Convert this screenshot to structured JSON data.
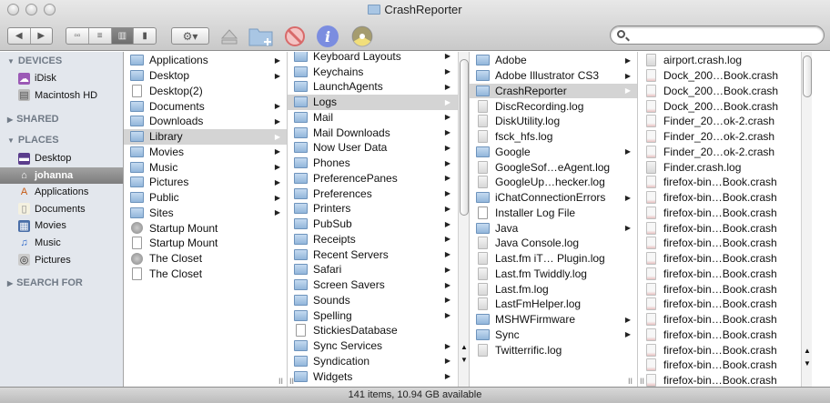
{
  "window": {
    "title": "CrashReporter"
  },
  "toolbar": {
    "nav": [
      {
        "name": "back-button",
        "icon": "◀"
      },
      {
        "name": "forward-button",
        "icon": "▶"
      }
    ],
    "views": [
      {
        "name": "icon-view-button",
        "icon": "▫▫",
        "active": false
      },
      {
        "name": "list-view-button",
        "icon": "≡",
        "active": false
      },
      {
        "name": "column-view-button",
        "icon": "▥",
        "active": true
      },
      {
        "name": "coverflow-view-button",
        "icon": "▮",
        "active": false
      }
    ],
    "action_icon": "⚙▾",
    "search": {
      "value": "",
      "placeholder": ""
    }
  },
  "sidebar": {
    "sections": [
      {
        "label": "DEVICES",
        "expanded": true,
        "items": [
          {
            "label": "iDisk",
            "icon": "idisk"
          },
          {
            "label": "Macintosh HD",
            "icon": "harddisk"
          }
        ]
      },
      {
        "label": "SHARED",
        "expanded": false,
        "items": []
      },
      {
        "label": "PLACES",
        "expanded": true,
        "items": [
          {
            "label": "Desktop",
            "icon": "desktop"
          },
          {
            "label": "johanna",
            "icon": "home",
            "selected": true
          },
          {
            "label": "Applications",
            "icon": "applications"
          },
          {
            "label": "Documents",
            "icon": "documents"
          },
          {
            "label": "Movies",
            "icon": "movies"
          },
          {
            "label": "Music",
            "icon": "music"
          },
          {
            "label": "Pictures",
            "icon": "pictures"
          }
        ]
      },
      {
        "label": "SEARCH FOR",
        "expanded": false,
        "items": []
      }
    ]
  },
  "columns": [
    {
      "items": [
        {
          "label": "Applications",
          "kind": "folder",
          "arrow": true
        },
        {
          "label": "Desktop",
          "kind": "folder",
          "arrow": true
        },
        {
          "label": "Desktop(2)",
          "kind": "doc"
        },
        {
          "label": "Documents",
          "kind": "folder",
          "arrow": true
        },
        {
          "label": "Downloads",
          "kind": "folder",
          "arrow": true
        },
        {
          "label": "Library",
          "kind": "folder",
          "arrow": true,
          "selected": true
        },
        {
          "label": "Movies",
          "kind": "folder",
          "arrow": true
        },
        {
          "label": "Music",
          "kind": "folder",
          "arrow": true
        },
        {
          "label": "Pictures",
          "kind": "folder",
          "arrow": true
        },
        {
          "label": "Public",
          "kind": "folder",
          "arrow": true
        },
        {
          "label": "Sites",
          "kind": "folder",
          "arrow": true
        },
        {
          "label": "Startup Mount",
          "kind": "alias"
        },
        {
          "label": "Startup Mount",
          "kind": "doc"
        },
        {
          "label": "The Closet",
          "kind": "alias"
        },
        {
          "label": "The Closet",
          "kind": "doc"
        }
      ]
    },
    {
      "items": [
        {
          "label": "Keyboard Layouts",
          "kind": "folder",
          "arrow": true
        },
        {
          "label": "Keychains",
          "kind": "folder",
          "arrow": true
        },
        {
          "label": "LaunchAgents",
          "kind": "folder",
          "arrow": true
        },
        {
          "label": "Logs",
          "kind": "folder",
          "arrow": true,
          "selected": true
        },
        {
          "label": "Mail",
          "kind": "folder",
          "arrow": true
        },
        {
          "label": "Mail Downloads",
          "kind": "folder",
          "arrow": true
        },
        {
          "label": "Now User Data",
          "kind": "folder",
          "arrow": true
        },
        {
          "label": "Phones",
          "kind": "folder",
          "arrow": true
        },
        {
          "label": "PreferencePanes",
          "kind": "folder",
          "arrow": true
        },
        {
          "label": "Preferences",
          "kind": "folder",
          "arrow": true
        },
        {
          "label": "Printers",
          "kind": "folder",
          "arrow": true
        },
        {
          "label": "PubSub",
          "kind": "folder",
          "arrow": true
        },
        {
          "label": "Receipts",
          "kind": "folder",
          "arrow": true
        },
        {
          "label": "Recent Servers",
          "kind": "folder",
          "arrow": true
        },
        {
          "label": "Safari",
          "kind": "folder",
          "arrow": true
        },
        {
          "label": "Screen Savers",
          "kind": "folder",
          "arrow": true
        },
        {
          "label": "Sounds",
          "kind": "folder",
          "arrow": true
        },
        {
          "label": "Spelling",
          "kind": "folder",
          "arrow": true
        },
        {
          "label": "StickiesDatabase",
          "kind": "doc"
        },
        {
          "label": "Sync Services",
          "kind": "folder",
          "arrow": true
        },
        {
          "label": "Syndication",
          "kind": "folder",
          "arrow": true
        },
        {
          "label": "Widgets",
          "kind": "folder",
          "arrow": true
        }
      ]
    },
    {
      "items": [
        {
          "label": "Adobe",
          "kind": "folder",
          "arrow": true
        },
        {
          "label": "Adobe Illustrator CS3",
          "kind": "folder",
          "arrow": true
        },
        {
          "label": "CrashReporter",
          "kind": "folder",
          "arrow": true,
          "selected": true
        },
        {
          "label": "DiscRecording.log",
          "kind": "log"
        },
        {
          "label": "DiskUtility.log",
          "kind": "log"
        },
        {
          "label": "fsck_hfs.log",
          "kind": "log"
        },
        {
          "label": "Google",
          "kind": "folder",
          "arrow": true
        },
        {
          "label": "GoogleSof…eAgent.log",
          "kind": "log"
        },
        {
          "label": "GoogleUp…hecker.log",
          "kind": "log"
        },
        {
          "label": "iChatConnectionErrors",
          "kind": "folder",
          "arrow": true
        },
        {
          "label": "Installer Log File",
          "kind": "doc"
        },
        {
          "label": "Java",
          "kind": "folder",
          "arrow": true
        },
        {
          "label": "Java Console.log",
          "kind": "log"
        },
        {
          "label": "Last.fm iT… Plugin.log",
          "kind": "log"
        },
        {
          "label": "Last.fm Twiddly.log",
          "kind": "log"
        },
        {
          "label": "Last.fm.log",
          "kind": "log"
        },
        {
          "label": "LastFmHelper.log",
          "kind": "log"
        },
        {
          "label": "MSHWFirmware",
          "kind": "folder",
          "arrow": true
        },
        {
          "label": "Sync",
          "kind": "folder",
          "arrow": true
        },
        {
          "label": "Twitterrific.log",
          "kind": "log"
        }
      ]
    },
    {
      "items": [
        {
          "label": "airport.crash.log",
          "kind": "log"
        },
        {
          "label": "Dock_200…Book.crash",
          "kind": "crash"
        },
        {
          "label": "Dock_200…Book.crash",
          "kind": "crash"
        },
        {
          "label": "Dock_200…Book.crash",
          "kind": "crash"
        },
        {
          "label": "Finder_20…ok-2.crash",
          "kind": "crash"
        },
        {
          "label": "Finder_20…ok-2.crash",
          "kind": "crash"
        },
        {
          "label": "Finder_20…ok-2.crash",
          "kind": "crash"
        },
        {
          "label": "Finder.crash.log",
          "kind": "log"
        },
        {
          "label": "firefox-bin…Book.crash",
          "kind": "crash"
        },
        {
          "label": "firefox-bin…Book.crash",
          "kind": "crash"
        },
        {
          "label": "firefox-bin…Book.crash",
          "kind": "crash"
        },
        {
          "label": "firefox-bin…Book.crash",
          "kind": "crash"
        },
        {
          "label": "firefox-bin…Book.crash",
          "kind": "crash"
        },
        {
          "label": "firefox-bin…Book.crash",
          "kind": "crash"
        },
        {
          "label": "firefox-bin…Book.crash",
          "kind": "crash"
        },
        {
          "label": "firefox-bin…Book.crash",
          "kind": "crash"
        },
        {
          "label": "firefox-bin…Book.crash",
          "kind": "crash"
        },
        {
          "label": "firefox-bin…Book.crash",
          "kind": "crash"
        },
        {
          "label": "firefox-bin…Book.crash",
          "kind": "crash"
        },
        {
          "label": "firefox-bin…Book.crash",
          "kind": "crash"
        },
        {
          "label": "firefox-bin…Book.crash",
          "kind": "crash"
        },
        {
          "label": "firefox-bin…Book.crash",
          "kind": "crash"
        }
      ]
    }
  ],
  "status": {
    "text": "141 items, 10.94 GB available"
  },
  "colors": {
    "selection": "#d4d4d4",
    "sidebar_bg": "#e3e7ed",
    "folder": "#a9c6e4"
  }
}
